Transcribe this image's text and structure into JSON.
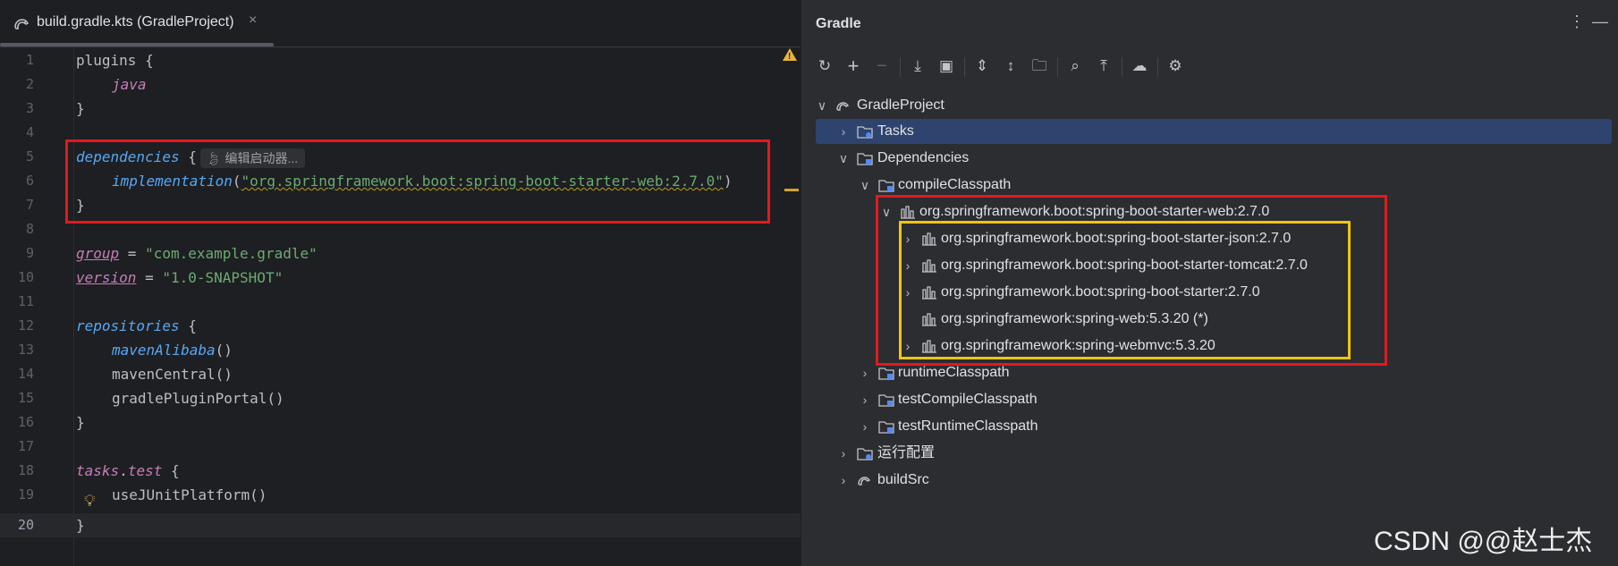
{
  "editor": {
    "tab_title": "build.gradle.kts (GradleProject)",
    "tab_close": "×",
    "inlay_hint": "编辑启动器...",
    "lines": [
      {
        "n": "1"
      },
      {
        "n": "2"
      },
      {
        "n": "3"
      },
      {
        "n": "4"
      },
      {
        "n": "5"
      },
      {
        "n": "6"
      },
      {
        "n": "7"
      },
      {
        "n": "8"
      },
      {
        "n": "9"
      },
      {
        "n": "10"
      },
      {
        "n": "11"
      },
      {
        "n": "12"
      },
      {
        "n": "13"
      },
      {
        "n": "14"
      },
      {
        "n": "15"
      },
      {
        "n": "16"
      },
      {
        "n": "17"
      },
      {
        "n": "18"
      },
      {
        "n": "19"
      },
      {
        "n": "20"
      }
    ],
    "code": {
      "l1": "plugins {",
      "l2": "java",
      "l3": "}",
      "l5_kw": "dependencies",
      "l5_brace": " {",
      "l6_fn": "implementation",
      "l6_open": "(",
      "l6_str": "\"org.springframework.boot:spring-boot-starter-web:2.7.0\"",
      "l6_close": ")",
      "l7": "}",
      "l9_prop": "group",
      "l9_eq": " = ",
      "l9_str": "\"com.example.gradle\"",
      "l10_prop": "version",
      "l10_eq": " = ",
      "l10_str": "\"1.0-SNAPSHOT\"",
      "l12_kw": "repositories",
      "l12_brace": " {",
      "l13_fn": "mavenAlibaba",
      "l13_paren": "()",
      "l14": "mavenCentral()",
      "l15": "gradlePluginPortal()",
      "l16": "}",
      "l18_a": "tasks",
      "l18_dot": ".",
      "l18_b": "test",
      "l18_brace": " {",
      "l19": "useJUnitPlatform()",
      "l20": "}"
    }
  },
  "gradle": {
    "title": "Gradle",
    "more": "⋮",
    "minimize": "—",
    "toolbar_icons": [
      "reload-icon",
      "add-icon",
      "remove-icon",
      "download-sources-icon",
      "run-task-icon",
      "expand-all-icon",
      "collapse-all-icon",
      "link-project-icon",
      "analyze-dependencies-icon",
      "show-dependencies-icon",
      "offline-mode-icon",
      "settings-icon"
    ],
    "tree": {
      "root": "GradleProject",
      "tasks": "Tasks",
      "dependencies": "Dependencies",
      "compileClasspath": "compileClasspath",
      "starter_web": "org.springframework.boot:spring-boot-starter-web:2.7.0",
      "children": [
        "org.springframework.boot:spring-boot-starter-json:2.7.0",
        "org.springframework.boot:spring-boot-starter-tomcat:2.7.0",
        "org.springframework.boot:spring-boot-starter:2.7.0",
        "org.springframework:spring-web:5.3.20 (*)",
        "org.springframework:spring-webmvc:5.3.20"
      ],
      "runtimeClasspath": "runtimeClasspath",
      "testCompileClasspath": "testCompileClasspath",
      "testRuntimeClasspath": "testRuntimeClasspath",
      "run_config": "运行配置",
      "buildSrc": "buildSrc"
    }
  },
  "watermark": "CSDN @@赵士杰",
  "colors": {
    "highlight_red": "#e4181e",
    "highlight_yellow": "#f1c40f",
    "selection": "#2e436e"
  }
}
